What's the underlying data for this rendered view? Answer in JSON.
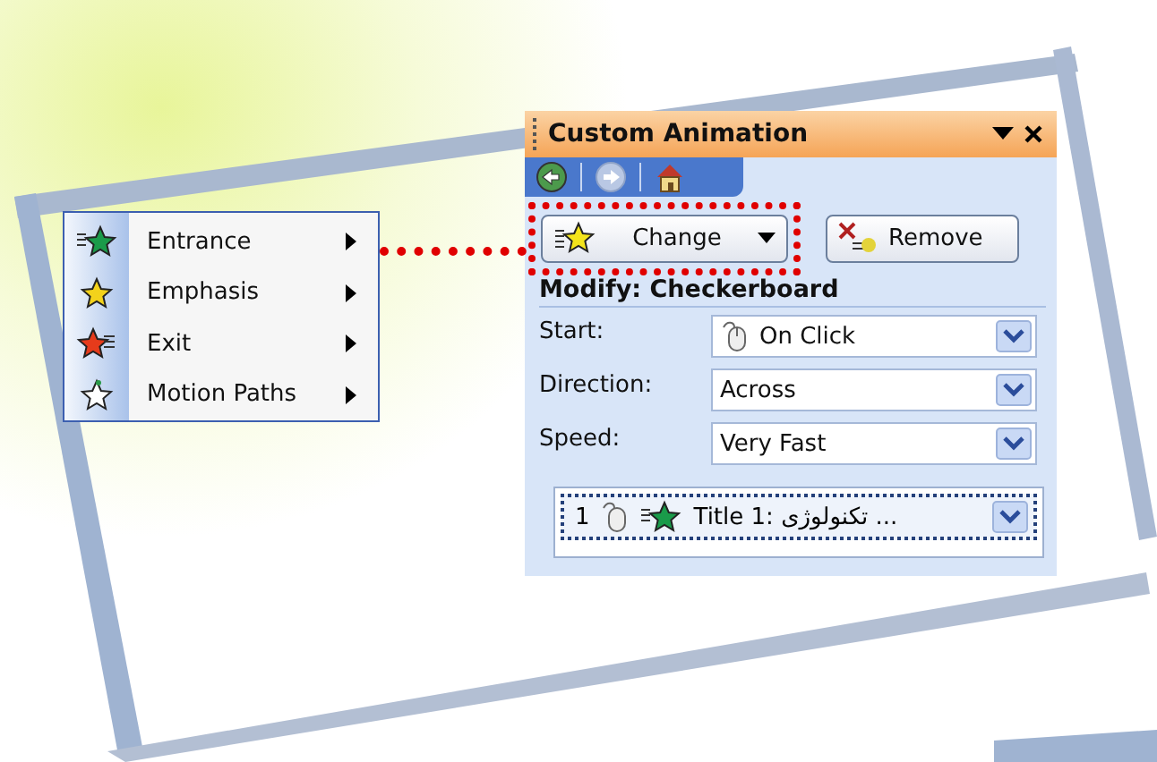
{
  "menu": {
    "items": [
      {
        "label": "Entrance",
        "kind": "entrance"
      },
      {
        "label": "Emphasis",
        "kind": "emphasis"
      },
      {
        "label": "Exit",
        "kind": "exit"
      },
      {
        "label": "Motion Paths",
        "kind": "motion"
      }
    ]
  },
  "panel": {
    "title": "Custom Animation",
    "nav": [
      {
        "kind": "back",
        "disabled": false
      },
      {
        "kind": "forward",
        "disabled": true
      },
      {
        "kind": "home",
        "disabled": false
      }
    ],
    "change_button": {
      "label": "Change",
      "highlighted": true
    },
    "remove_button": {
      "label": "Remove"
    },
    "section_title": "Modify: Checkerboard",
    "fields": [
      {
        "label": "Start:",
        "value": "On Click",
        "kind": "mouse"
      },
      {
        "label": "Direction:",
        "value": "Across",
        "kind": "plain"
      },
      {
        "label": "Speed:",
        "value": "Very Fast",
        "kind": "plain"
      }
    ],
    "list": [
      {
        "number": "1",
        "text": "Title 1: تکنولوژی ...",
        "selected": true
      }
    ]
  }
}
